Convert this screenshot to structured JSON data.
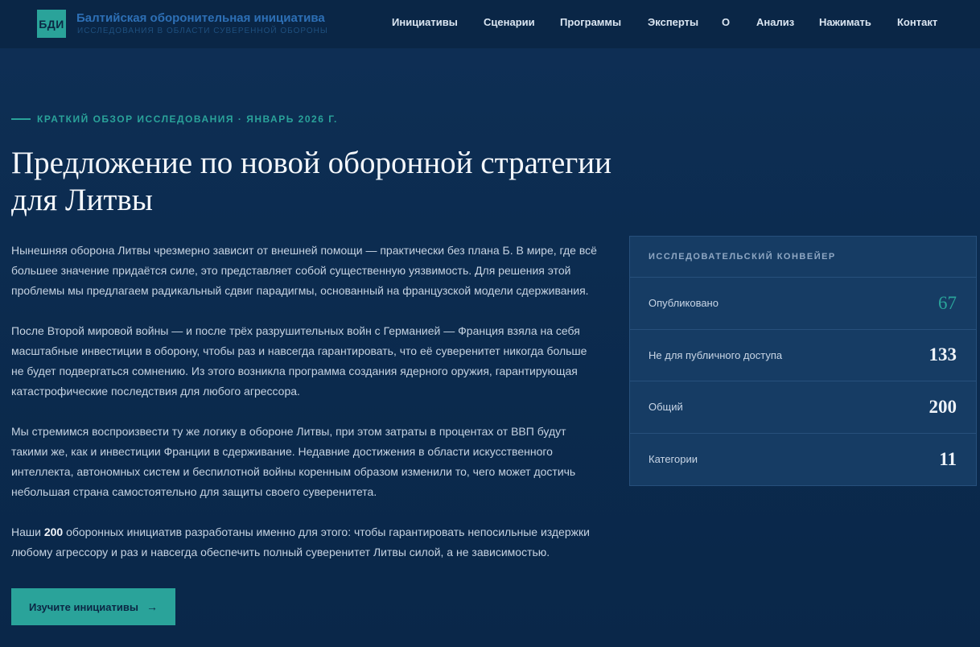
{
  "brand": {
    "logo": "БДИ",
    "title": "Балтийская оборонительная инициатива",
    "subtitle": "ИССЛЕДОВАНИЯ В ОБЛАСТИ СУВЕРЕННОЙ ОБОРОНЫ"
  },
  "nav": [
    {
      "label": "Инициативы"
    },
    {
      "label": "Сценарии"
    },
    {
      "label": "Программы"
    },
    {
      "label": "Эксперты"
    },
    {
      "label": "О"
    },
    {
      "label": "Анализ"
    },
    {
      "label": "Нажимать"
    },
    {
      "label": "Контакт"
    }
  ],
  "hero": {
    "kicker": "КРАТКИЙ ОБЗОР ИССЛЕДОВАНИЯ · ЯНВАРЬ 2026 Г.",
    "title": "Предложение по новой оборонной стратегии для Литвы",
    "p1": "Нынешняя оборона Литвы чрезмерно зависит от внешней помощи — практически без плана Б. В мире, где всё большее значение придаётся силе, это представляет собой существенную уязвимость. Для решения этой проблемы мы предлагаем радикальный сдвиг парадигмы, основанный на французской модели сдерживания.",
    "p2": "После Второй мировой войны — и после трёх разрушительных войн с Германией — Франция взяла на себя масштабные инвестиции в оборону, чтобы раз и навсегда гарантировать, что её суверенитет никогда больше не будет подвергаться сомнению. Из этого возникла программа создания ядерного оружия, гарантирующая катастрофические последствия для любого агрессора.",
    "p3": "Мы стремимся воспроизвести ту же логику в обороне Литвы, при этом затраты в процентах от ВВП будут такими же, как и инвестиции Франции в сдерживание. Недавние достижения в области искусственного интеллекта, автономных систем и беспилотной войны коренным образом изменили то, чего может достичь небольшая страна самостоятельно для защиты своего суверенитета.",
    "p4_prefix": "Наши ",
    "p4_strong": "200",
    "p4_suffix": " оборонных инициатив разработаны именно для этого: чтобы гарантировать непосильные издержки любому агрессору и раз и навсегда обеспечить полный суверенитет Литвы силой, а не зависимостью.",
    "cta_label": "Изучите инициативы",
    "cta_icon": "arrow-right-icon"
  },
  "pipeline": {
    "heading": "ИССЛЕДОВАТЕЛЬСКИЙ КОНВЕЙЕР",
    "stats": [
      {
        "label": "Опубликовано",
        "value": "67"
      },
      {
        "label": "Не для публичного доступа",
        "value": "133"
      },
      {
        "label": "Общий",
        "value": "200"
      },
      {
        "label": "Категории",
        "value": "11"
      }
    ],
    "accent_color": "#2aa39a"
  }
}
